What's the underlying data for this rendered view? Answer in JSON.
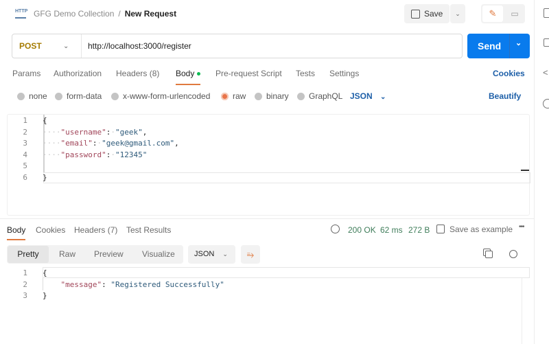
{
  "header": {
    "icon": "http-icon",
    "collection": "GFG Demo Collection",
    "separator": "/",
    "request_name": "New Request",
    "save_label": "Save"
  },
  "request": {
    "method": "POST",
    "url": "http://localhost:3000/register",
    "send_label": "Send",
    "method_color": "#a57b00",
    "send_color": "#097bed"
  },
  "tabs": [
    {
      "label": "Params"
    },
    {
      "label": "Authorization"
    },
    {
      "label": "Headers (8)"
    },
    {
      "label": "Body",
      "active": true
    },
    {
      "label": "Pre-request Script"
    },
    {
      "label": "Tests"
    },
    {
      "label": "Settings"
    }
  ],
  "cookies_label": "Cookies",
  "body_types": [
    {
      "label": "none"
    },
    {
      "label": "form-data"
    },
    {
      "label": "x-www-form-urlencoded"
    },
    {
      "label": "raw",
      "selected": true
    },
    {
      "label": "binary"
    },
    {
      "label": "GraphQL"
    }
  ],
  "body_format": "JSON",
  "beautify_label": "Beautify",
  "request_body": [
    {
      "n": "1",
      "text": "{"
    },
    {
      "n": "2",
      "key": "\"username\"",
      "value": "\"geek\"",
      "tail": ","
    },
    {
      "n": "3",
      "key": "\"email\"",
      "value": "\"geek@gmail.com\"",
      "tail": ","
    },
    {
      "n": "4",
      "key": "\"password\"",
      "value": "\"12345\"",
      "tail": ""
    },
    {
      "n": "5",
      "text": ""
    },
    {
      "n": "6",
      "text": "}"
    }
  ],
  "response": {
    "tabs": [
      {
        "label": "Body",
        "active": true
      },
      {
        "label": "Cookies"
      },
      {
        "label": "Headers (7)"
      },
      {
        "label": "Test Results"
      }
    ],
    "status": "200 OK",
    "time": "62 ms",
    "size": "272 B",
    "save_example": "Save as example",
    "views": [
      {
        "label": "Pretty",
        "active": true
      },
      {
        "label": "Raw"
      },
      {
        "label": "Preview"
      },
      {
        "label": "Visualize"
      }
    ],
    "format": "JSON",
    "body": [
      {
        "n": "1",
        "text": "{"
      },
      {
        "n": "2",
        "key": "\"message\"",
        "value": "\"Registered Successfully\""
      },
      {
        "n": "3",
        "text": "}"
      }
    ]
  }
}
